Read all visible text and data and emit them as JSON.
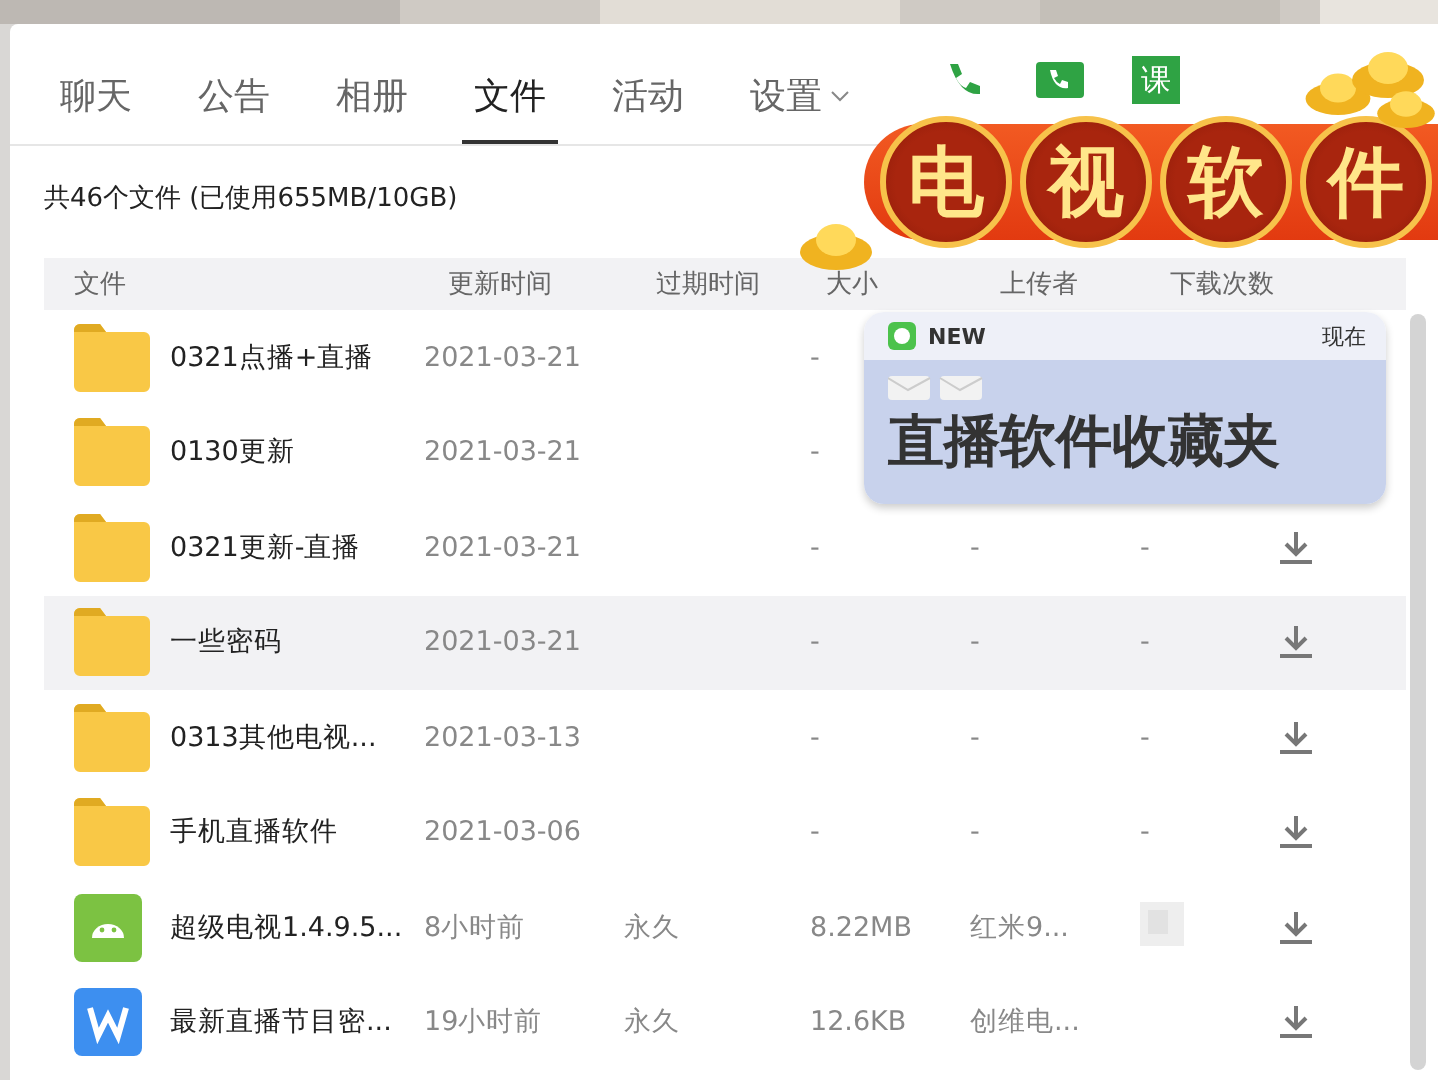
{
  "tabs": [
    {
      "label": "聊天",
      "selected": false,
      "kind": "plain"
    },
    {
      "label": "公告",
      "selected": false,
      "kind": "plain"
    },
    {
      "label": "相册",
      "selected": false,
      "kind": "plain"
    },
    {
      "label": "文件",
      "selected": true,
      "kind": "plain"
    },
    {
      "label": "活动",
      "selected": false,
      "kind": "plain"
    },
    {
      "label": "设置",
      "selected": false,
      "kind": "dropdown"
    }
  ],
  "action_badge": "课",
  "summary": "共46个文件 (已使用655MB/10GB)",
  "columns": [
    "文件",
    "更新时间",
    "过期时间",
    "大小",
    "上传者",
    "下载次数"
  ],
  "rows": [
    {
      "kind": "folder",
      "name": "0321点播+直播",
      "updated": "2021-03-21",
      "size": "-",
      "selected": false
    },
    {
      "kind": "folder",
      "name": "0130更新",
      "updated": "2021-03-21",
      "size": "-",
      "selected": false
    },
    {
      "kind": "folder",
      "name": "0321更新-直播",
      "updated": "2021-03-21",
      "size": "-",
      "uploader": "-",
      "downloads": "-",
      "selected": false,
      "download": true
    },
    {
      "kind": "folder",
      "name": "一些密码",
      "updated": "2021-03-21",
      "size": "-",
      "uploader": "-",
      "downloads": "-",
      "selected": true,
      "download": true
    },
    {
      "kind": "folder",
      "name": "0313其他电视...",
      "updated": "2021-03-13",
      "size": "-",
      "uploader": "-",
      "downloads": "-",
      "selected": false,
      "download": true
    },
    {
      "kind": "folder",
      "name": "手机直播软件",
      "updated": "2021-03-06",
      "size": "-",
      "uploader": "-",
      "downloads": "-",
      "selected": false,
      "download": true
    },
    {
      "kind": "apk",
      "name": "超级电视1.4.9.5...",
      "updated": "8小时前",
      "expiry": "永久",
      "size": "8.22MB",
      "uploader": "红米9...",
      "downloads_blurred": true,
      "selected": false,
      "download": true
    },
    {
      "kind": "doc",
      "name": "最新直播节目密...",
      "updated": "19小时前",
      "expiry": "永久",
      "size": "12.6KB",
      "uploader": "创维电...",
      "selected": false,
      "download": true
    }
  ],
  "banner": {
    "chars": [
      "电",
      "视",
      "软",
      "件"
    ]
  },
  "notification": {
    "app": "NEW",
    "time": "现在",
    "message": "直播软件收藏夹"
  }
}
